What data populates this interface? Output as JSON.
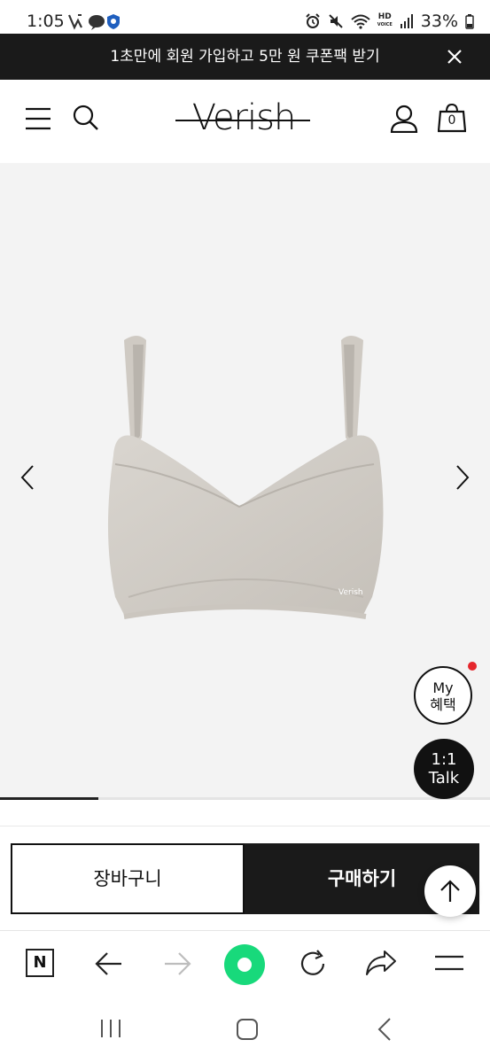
{
  "status_bar": {
    "time": "1:05",
    "battery": "33%",
    "hd_label": "HD",
    "voice_label": "VOICE"
  },
  "banner": {
    "text": "1초만에 회원 가입하고 5만 원 쿠폰팩 받기"
  },
  "header": {
    "logo": "Verish",
    "cart_count": "0"
  },
  "product": {
    "image_brand": "Verish",
    "background_color": "#f3f3f3",
    "image_progress": 0.2
  },
  "floating": {
    "my_line1": "My",
    "my_line2": "혜택",
    "talk_line1": "1:1",
    "talk_line2": "Talk"
  },
  "actions": {
    "cart_label": "장바구니",
    "buy_label": "구매하기"
  },
  "browser_toolbar": {
    "n_label": "N",
    "accent": "#18d97b"
  }
}
